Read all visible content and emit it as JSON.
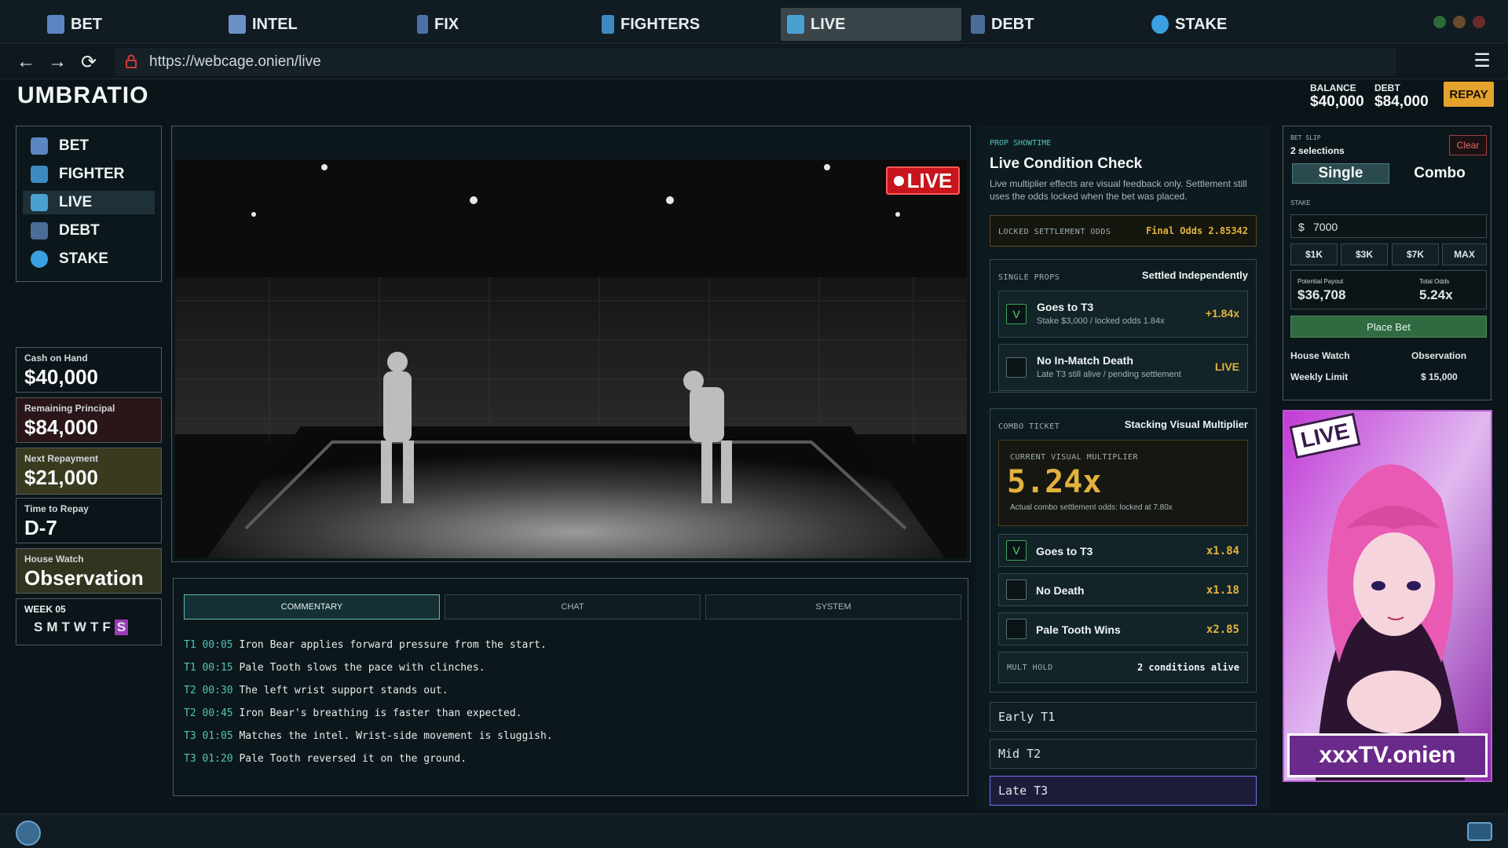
{
  "tabs": [
    {
      "label": "BET",
      "color": "#5a86c4"
    },
    {
      "label": "INTEL",
      "color": "#6c90c8"
    },
    {
      "label": "FIX",
      "color": "#4a72a8"
    },
    {
      "label": "FIGHTERS",
      "color": "#3c8ac0"
    },
    {
      "label": "LIVE",
      "color": "#4aa0d0",
      "active": true
    },
    {
      "label": "DEBT",
      "color": "#4a6e98"
    },
    {
      "label": "STAKE",
      "color": "#3aa0e0"
    }
  ],
  "browser": {
    "url": "https://webcage.onien/live",
    "back": "←",
    "forward": "→",
    "reload": "⟳",
    "menu": "☰"
  },
  "header": {
    "brand": "UMBRATIO",
    "balance_label": "BALANCE",
    "balance_value": "$40,000",
    "debt_label": "DEBT",
    "debt_value": "$84,000",
    "repay_label": "REPAY"
  },
  "sidenav": [
    {
      "label": "BET"
    },
    {
      "label": "FIGHTER"
    },
    {
      "label": "LIVE",
      "active": true
    },
    {
      "label": "DEBT"
    },
    {
      "label": "STAKE"
    }
  ],
  "stats": {
    "cash": {
      "label": "Cash on Hand",
      "value": "$40,000"
    },
    "principal": {
      "label": "Remaining Principal",
      "value": "$84,000"
    },
    "repayment": {
      "label": "Next Repayment",
      "value": "$21,000"
    },
    "time": {
      "label": "Time to Repay",
      "value": "D-7"
    },
    "house": {
      "label": "House Watch",
      "value": "Observation"
    },
    "week": {
      "label": "WEEK 05",
      "days": [
        "S",
        "M",
        "T",
        "W",
        "T",
        "F",
        "S"
      ]
    }
  },
  "video": {
    "live_label": "LIVE"
  },
  "commentary": {
    "tabs": [
      "COMMENTARY",
      "CHAT",
      "SYSTEM"
    ],
    "lines": [
      {
        "ts": "T1 00:05",
        "text": "Iron Bear applies forward pressure from the start."
      },
      {
        "ts": "T1 00:15",
        "text": "Pale Tooth slows the pace with clinches."
      },
      {
        "ts": "T2 00:30",
        "text": "The left wrist support stands out."
      },
      {
        "ts": "T2 00:45",
        "text": "Iron Bear's breathing is faster than expected."
      },
      {
        "ts": "T3 01:05",
        "text": "Matches the intel. Wrist-side movement is sluggish."
      },
      {
        "ts": "T3 01:20",
        "text": "Pale Tooth reversed it on the ground."
      }
    ]
  },
  "prop": {
    "kicker": "PROP SHOWTIME",
    "title": "Live Condition Check",
    "desc": "Live multiplier effects are visual feedback only. Settlement still uses the odds locked when the bet was placed.",
    "locked_label": "LOCKED SETTLEMENT ODDS",
    "locked_value": "Final Odds 2.85342",
    "single_label": "SINGLE PROPS",
    "single_note": "Settled Independently",
    "single": [
      {
        "check": "V",
        "title": "Goes to T3",
        "sub": "Stake $3,000 / locked odds 1.84x",
        "value": "+1.84x"
      },
      {
        "check": "",
        "title": "No In-Match Death",
        "sub": "Late T3 still alive / pending settlement",
        "value": "LIVE"
      }
    ],
    "combo_label": "COMBO TICKET",
    "combo_note": "Stacking Visual Multiplier",
    "mult_label": "CURRENT VISUAL MULTIPLIER",
    "mult_value": "5.24x",
    "mult_note": "Actual combo settlement odds: locked at 7.80x",
    "combo": [
      {
        "check": "V",
        "title": "Goes to T3",
        "value": "x1.84"
      },
      {
        "check": "",
        "title": "No Death",
        "value": "x1.18"
      },
      {
        "check": "",
        "title": "Pale Tooth Wins",
        "value": "x2.85"
      }
    ],
    "hold_label": "MULT HOLD",
    "hold_value": "2 conditions alive",
    "phases": [
      "Early T1",
      "Mid T2",
      "Late T3"
    ]
  },
  "slip": {
    "kicker": "BET SLIP",
    "count": "2 selections",
    "clear": "Clear",
    "single": "Single",
    "combo": "Combo",
    "stake_label": "STAKE",
    "currency": "$",
    "stake_value": "7000",
    "quick": [
      "$1K",
      "$3K",
      "$7K",
      "MAX"
    ],
    "payout_label": "Potential Payout",
    "payout_value": "$36,708",
    "odds_label": "Total Odds",
    "odds_value": "5.24x",
    "place": "Place Bet",
    "watch_label": "House Watch",
    "watch_value": "Observation",
    "limit_label": "Weekly Limit",
    "limit_value": "$ 15,000"
  },
  "ad": {
    "live": "LIVE",
    "brand": "xxxTV.onien"
  }
}
